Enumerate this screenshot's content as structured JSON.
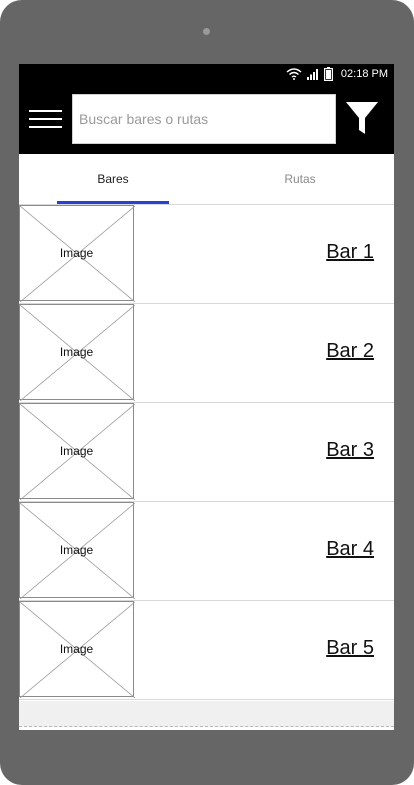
{
  "status_bar": {
    "time": "02:18 PM",
    "icons": [
      "wifi-icon",
      "signal-icon",
      "battery-icon"
    ]
  },
  "app_bar": {
    "menu_icon": "hamburger-menu-icon",
    "search": {
      "placeholder": "Buscar bares o rutas",
      "value": ""
    },
    "filter_icon": "filter-funnel-icon"
  },
  "tabs": [
    {
      "label": "Bares",
      "selected": true
    },
    {
      "label": "Rutas",
      "selected": false
    }
  ],
  "list": {
    "items": [
      {
        "image_label": "Image",
        "title": "Bar 1"
      },
      {
        "image_label": "Image",
        "title": "Bar 2"
      },
      {
        "image_label": "Image",
        "title": "Bar 3"
      },
      {
        "image_label": "Image",
        "title": "Bar 4"
      },
      {
        "image_label": "Image",
        "title": "Bar 5"
      }
    ]
  },
  "colors": {
    "device_frame": "#666666",
    "app_bar": "#000000",
    "tab_indicator": "#2a3fd4",
    "divider": "#d8d8d8"
  }
}
